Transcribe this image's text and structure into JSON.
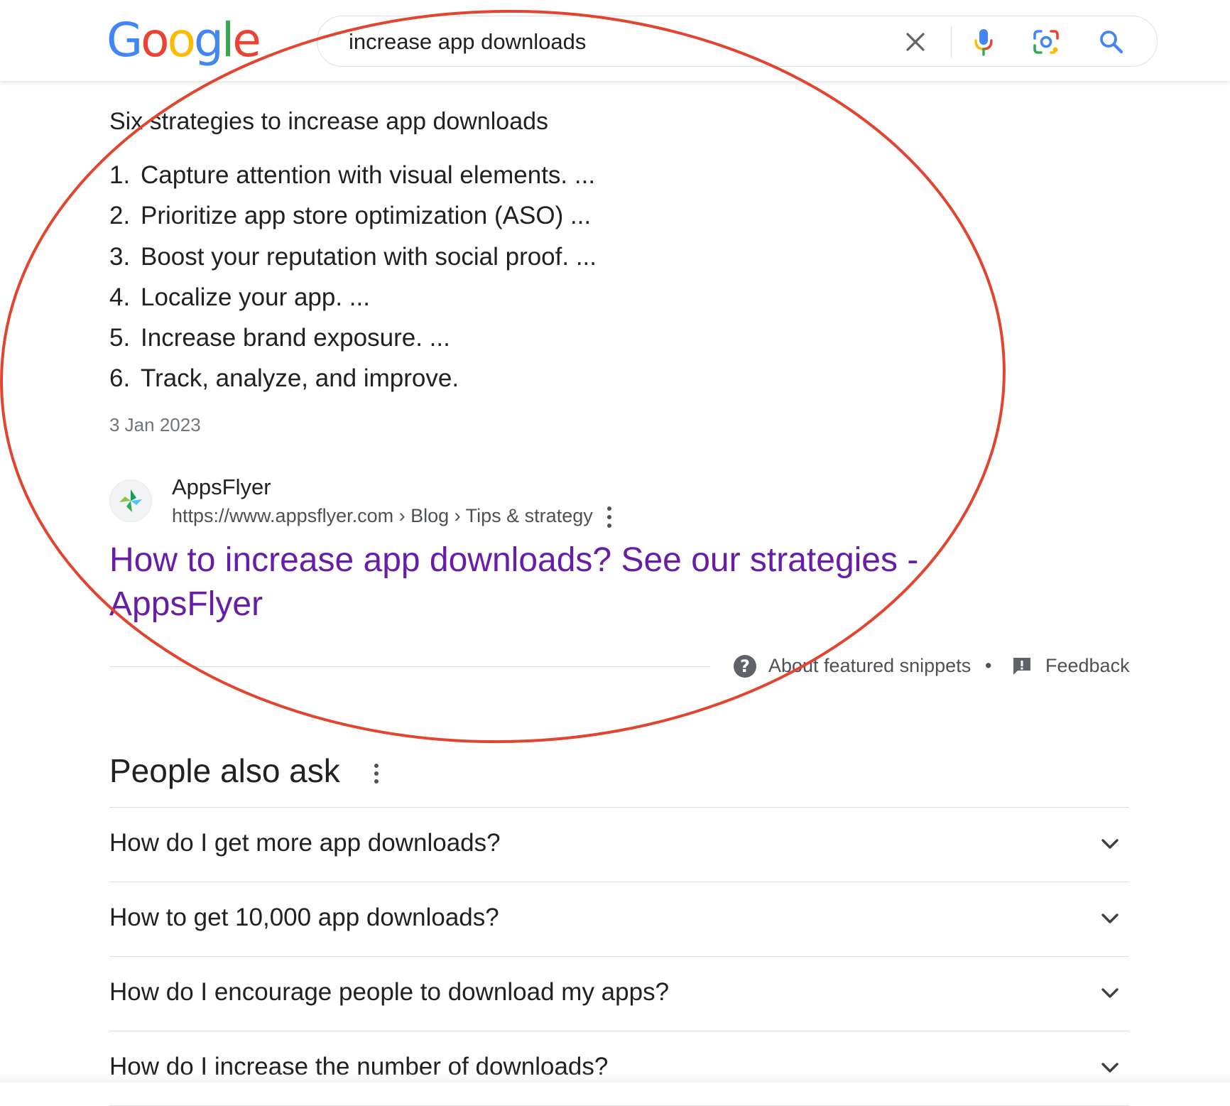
{
  "logo": {
    "letters": [
      "G",
      "o",
      "o",
      "g",
      "l",
      "e"
    ],
    "colors": [
      "#4285F4",
      "#EA4335",
      "#FBBC05",
      "#4285F4",
      "#34A853",
      "#EA4335"
    ]
  },
  "search": {
    "query": "increase app downloads",
    "clear_icon": "close-icon",
    "voice_icon": "mic-icon",
    "lens_icon": "lens-icon",
    "search_icon": "search-icon"
  },
  "snippet": {
    "heading": "Six strategies to increase app downloads",
    "items": [
      {
        "num": "1.",
        "text": "Capture attention with visual elements. ..."
      },
      {
        "num": "2.",
        "text": "Prioritize app store optimization (ASO) ..."
      },
      {
        "num": "3.",
        "text": "Boost your reputation with social proof. ..."
      },
      {
        "num": "4.",
        "text": "Localize your app. ..."
      },
      {
        "num": "5.",
        "text": "Increase brand exposure. ..."
      },
      {
        "num": "6.",
        "text": "Track, analyze, and improve."
      }
    ],
    "date": "3 Jan 2023",
    "source_name": "AppsFlyer",
    "source_url": "https://www.appsflyer.com › Blog › Tips & strategy",
    "title": "How to increase app downloads? See our strategies - AppsFlyer",
    "about": "About featured snippets",
    "separator": "•",
    "feedback": "Feedback"
  },
  "paa": {
    "heading": "People also ask",
    "questions": [
      "How do I get more app downloads?",
      "How to get 10,000 app downloads?",
      "How do I encourage people to download my apps?",
      "How do I increase the number of downloads?"
    ]
  },
  "colors": {
    "link_visited": "#681da8",
    "annotation": "#e2452f",
    "text": "#202124",
    "muted": "#4d5156"
  }
}
